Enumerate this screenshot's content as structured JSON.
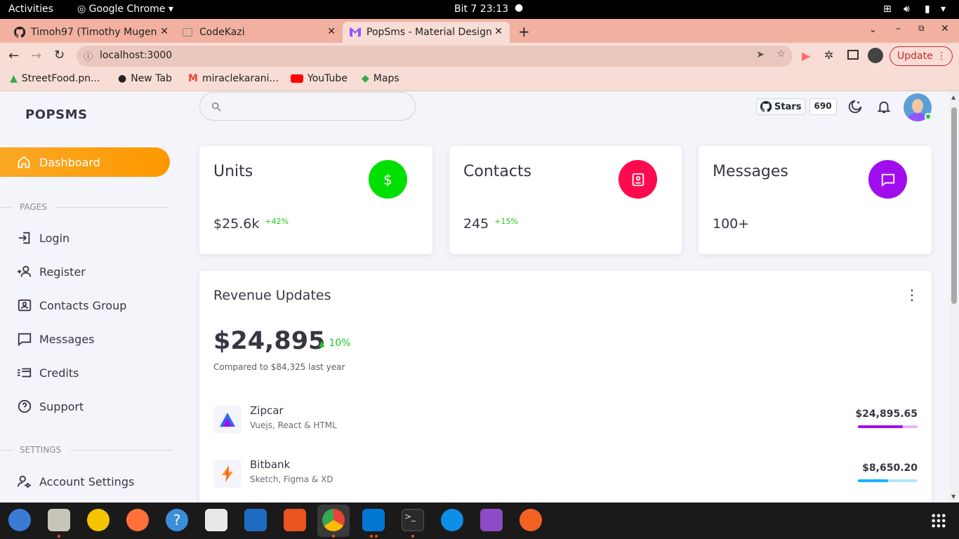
{
  "system_bar": {
    "activities": "Activities",
    "app_name": "Google Chrome",
    "clock": "Bit 7  23:13"
  },
  "browser": {
    "tabs": [
      {
        "label": "Timoh97 (Timothy Mugen"
      },
      {
        "label": "CodeKazi"
      },
      {
        "label": "PopSms - Material Design"
      }
    ],
    "url": "localhost:3000",
    "update_label": "Update",
    "bookmarks": [
      "StreetFood.pn...",
      "New Tab",
      "miraclekarani...",
      "YouTube",
      "Maps"
    ]
  },
  "sidebar": {
    "logo": "POPSMS",
    "active": "Dashboard",
    "pages_header": "PAGES",
    "pages": [
      "Login",
      "Register",
      "Contacts Group",
      "Messages",
      "Credits",
      "Support"
    ],
    "settings_header": "SETTINGS",
    "settings": [
      "Account Settings"
    ]
  },
  "header": {
    "stars_label": "Stars",
    "stars_count": "690"
  },
  "cards": [
    {
      "title": "Units",
      "value": "$25.6k",
      "pct": "+42%",
      "color": "#00e000"
    },
    {
      "title": "Contacts",
      "value": "245",
      "pct": "+15%",
      "color": "#ff0a4e"
    },
    {
      "title": "Messages",
      "value": "100+",
      "pct": "",
      "color": "#a10eee"
    }
  ],
  "revenue": {
    "title": "Revenue Updates",
    "value": "$24,895",
    "change": "10%",
    "compare": "Compared to $84,325 last year",
    "rows": [
      {
        "name": "Zipcar",
        "sub": "Vuejs, React & HTML",
        "amount": "$24,895.65",
        "progress": 0.75,
        "color": "#a10eee"
      },
      {
        "name": "Bitbank",
        "sub": "Sketch, Figma & XD",
        "amount": "$8,650.20",
        "progress": 0.5,
        "color": "#16b1ff"
      }
    ]
  }
}
